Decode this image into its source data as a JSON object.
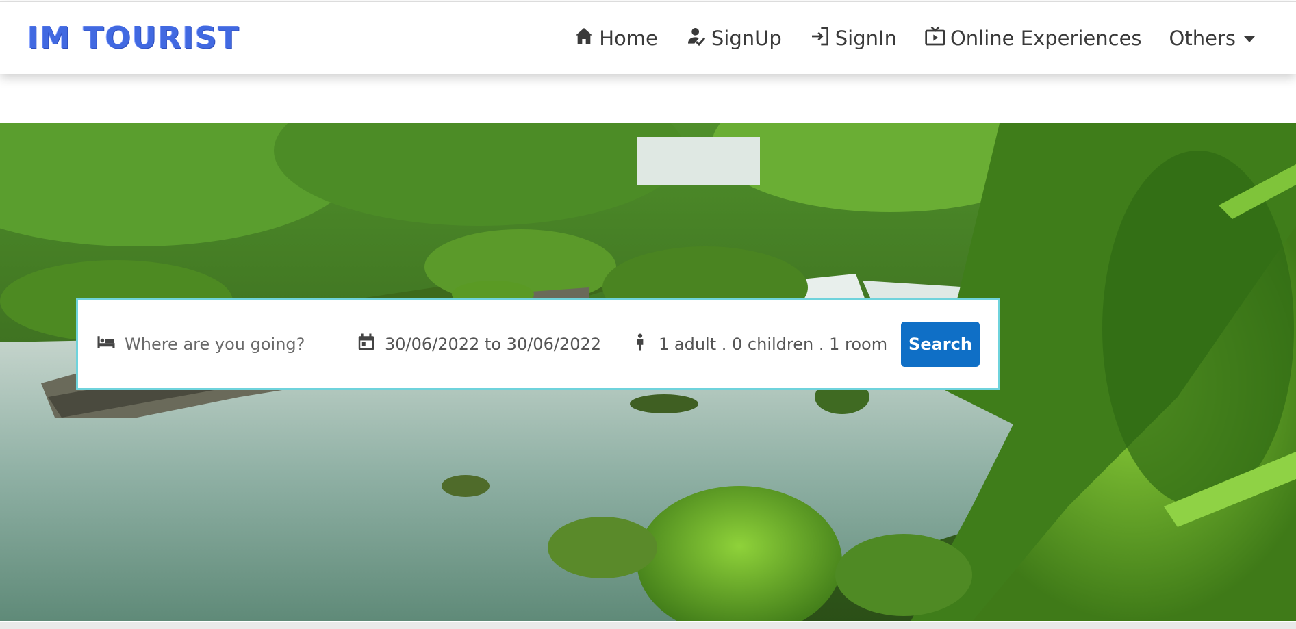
{
  "brand": {
    "text": "IM TOURIST",
    "color": "#4169e1"
  },
  "nav": {
    "items": [
      {
        "label": "Home",
        "icon": "home-icon"
      },
      {
        "label": "SignUp",
        "icon": "user-check-icon"
      },
      {
        "label": "SignIn",
        "icon": "login-arrow-icon"
      },
      {
        "label": "Online Experiences",
        "icon": "tv-play-icon"
      },
      {
        "label": "Others",
        "icon": "caret-down-icon"
      }
    ]
  },
  "search": {
    "destination_placeholder": "Where are you going?",
    "destination_value": "",
    "dates": "30/06/2022 to 30/06/2022",
    "guests": "1 adult . 0 children . 1 room",
    "button_label": "Search",
    "border_color": "#6fd3dc",
    "button_color": "#0f6fc6"
  },
  "hero": {
    "image": "forest-waterfall-stream"
  }
}
